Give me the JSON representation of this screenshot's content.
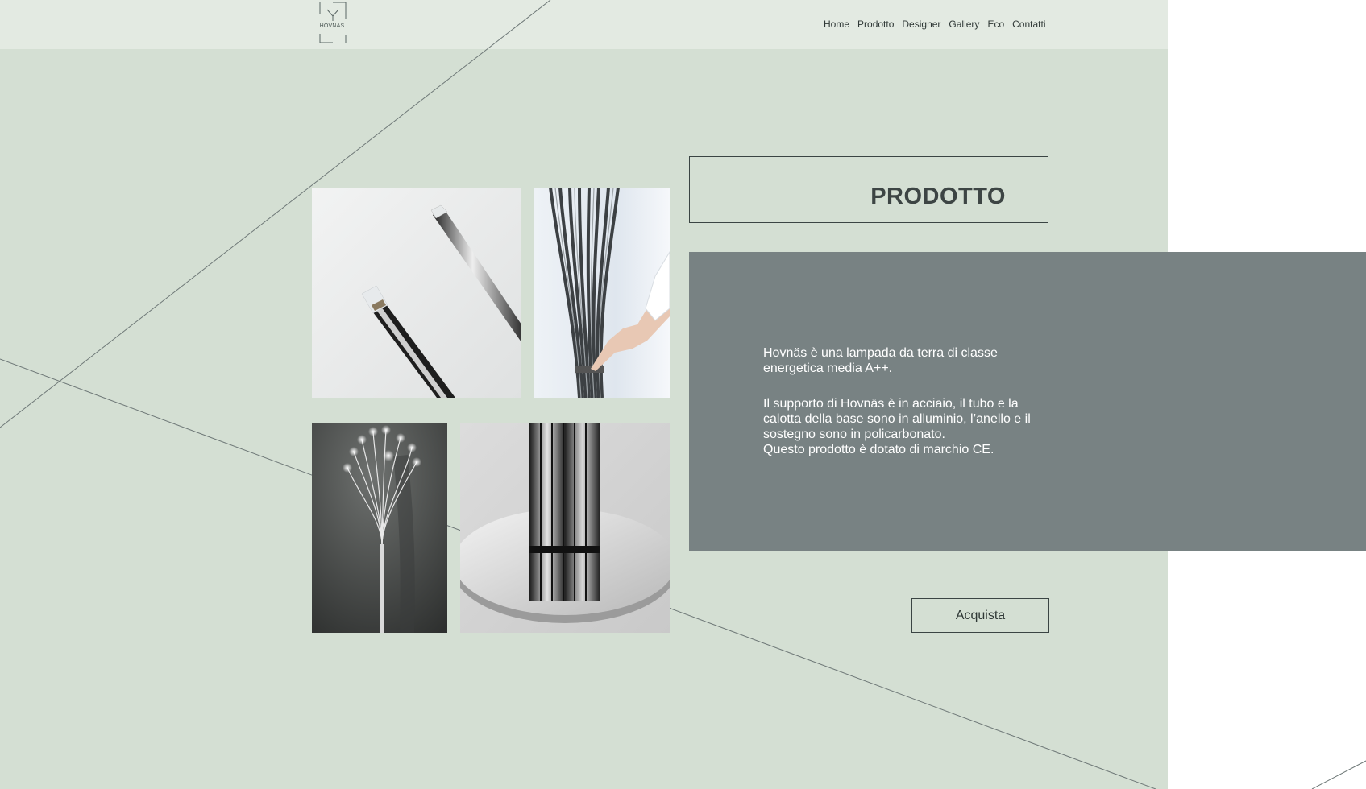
{
  "brand": {
    "logo_text": "HOVNÄS"
  },
  "nav": {
    "items": [
      {
        "label": "Home"
      },
      {
        "label": "Prodotto"
      },
      {
        "label": "Designer"
      },
      {
        "label": "Gallery"
      },
      {
        "label": "Eco"
      },
      {
        "label": "Contatti"
      }
    ]
  },
  "gallery": {
    "images": [
      {
        "icon": "lamp-tips-photo"
      },
      {
        "icon": "hand-touching-lamp-photo"
      },
      {
        "icon": "lit-floor-lamp-photo"
      },
      {
        "icon": "lamp-base-photo"
      }
    ]
  },
  "section": {
    "title": "PRODOTTO"
  },
  "description": {
    "paragraph_1": [
      "Hovnäs è una lampada da terra di classe",
      "energetica media A++."
    ],
    "paragraph_2": [
      "Il supporto di Hovnäs è in acciaio, il tubo e la",
      "calotta della base sono in alluminio, l’anello e il",
      "sostegno sono in policarbonato.",
      "Questo prodotto è dotato di marchio CE."
    ]
  },
  "actions": {
    "buy_label": "Acquista"
  },
  "colors": {
    "page_bg": "#d4dfd3",
    "header_bg": "#e3eae2",
    "panel_bg": "#788283",
    "text_dark": "#2f3836"
  }
}
